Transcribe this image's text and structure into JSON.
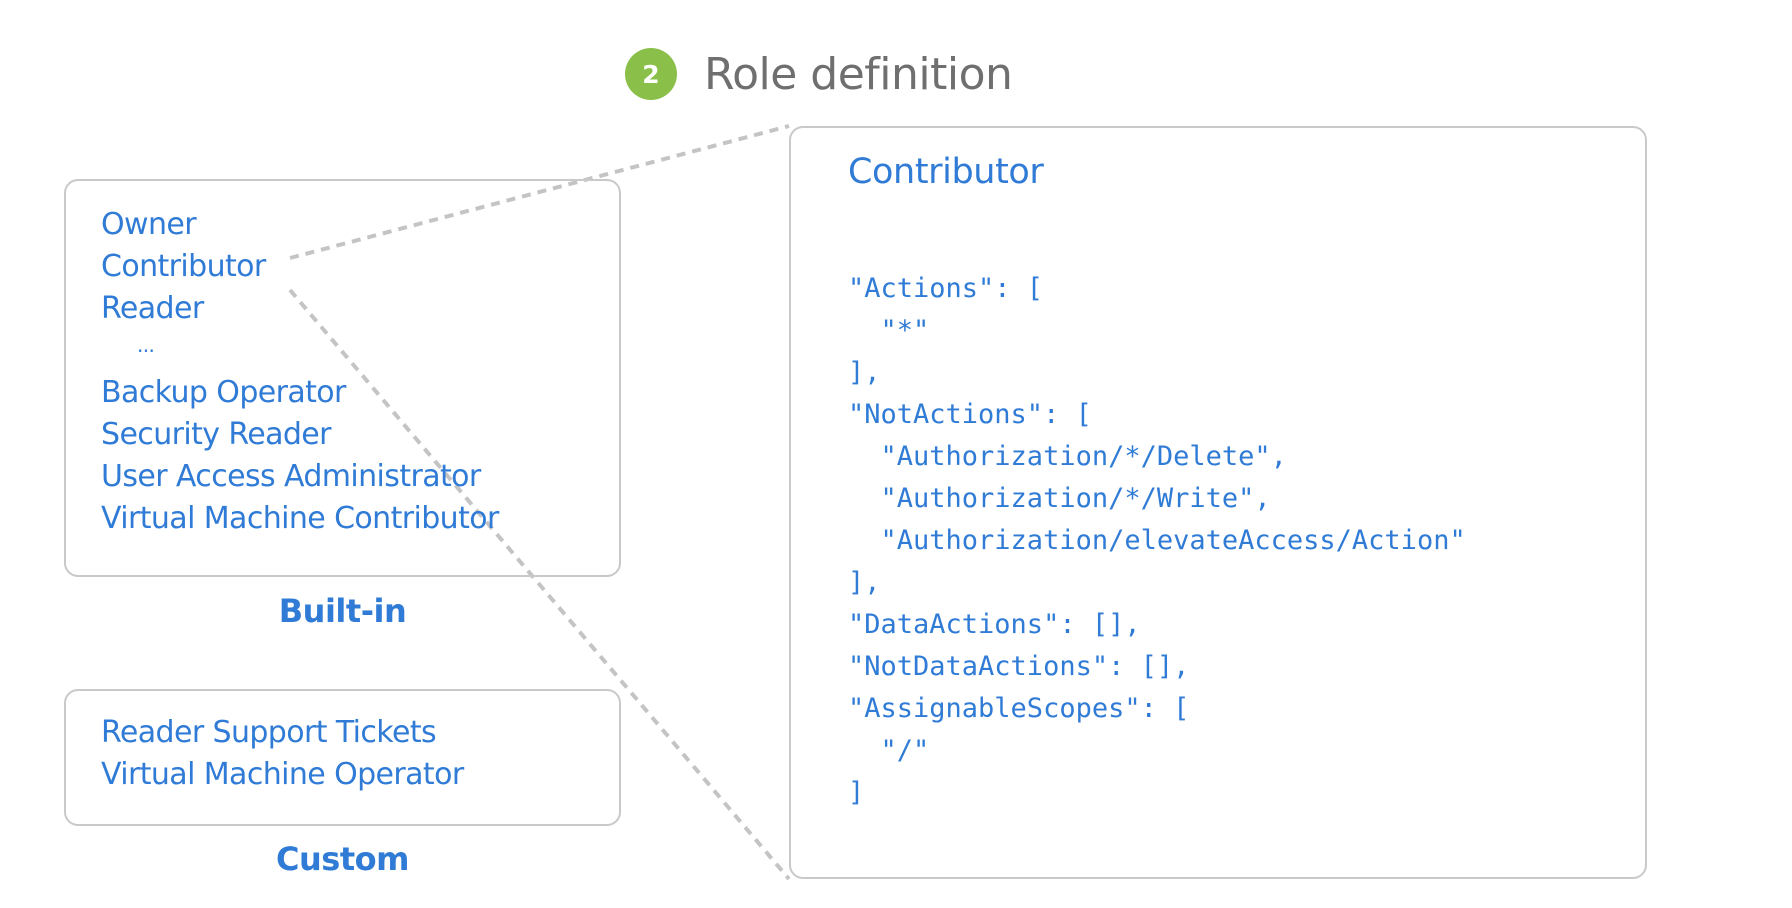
{
  "header": {
    "step_number": "2",
    "title": "Role definition"
  },
  "builtin": {
    "roles": [
      "Owner",
      "Contributor",
      "Reader",
      "...",
      "Backup Operator",
      "Security Reader",
      "User Access Administrator",
      "Virtual Machine Contributor"
    ],
    "label": "Built-in"
  },
  "custom": {
    "roles": [
      "Reader Support Tickets",
      "Virtual Machine Operator"
    ],
    "label": "Custom"
  },
  "definition": {
    "title": "Contributor",
    "json_lines": [
      "\"Actions\": [",
      "  \"*\"",
      "],",
      "\"NotActions\": [",
      "  \"Authorization/*/Delete\",",
      "  \"Authorization/*/Write\",",
      "  \"Authorization/elevateAccess/Action\"",
      "],",
      "\"DataActions\": [],",
      "\"NotDataActions\": [],",
      "\"AssignableScopes\": [",
      "  \"/\"",
      "]"
    ]
  },
  "colors": {
    "accent_blue": "#2f7bd6",
    "badge_green": "#8ac04a",
    "header_gray": "#6f6f6f",
    "border_gray": "#c9c9c9",
    "connector_gray": "#c4c4c4"
  }
}
